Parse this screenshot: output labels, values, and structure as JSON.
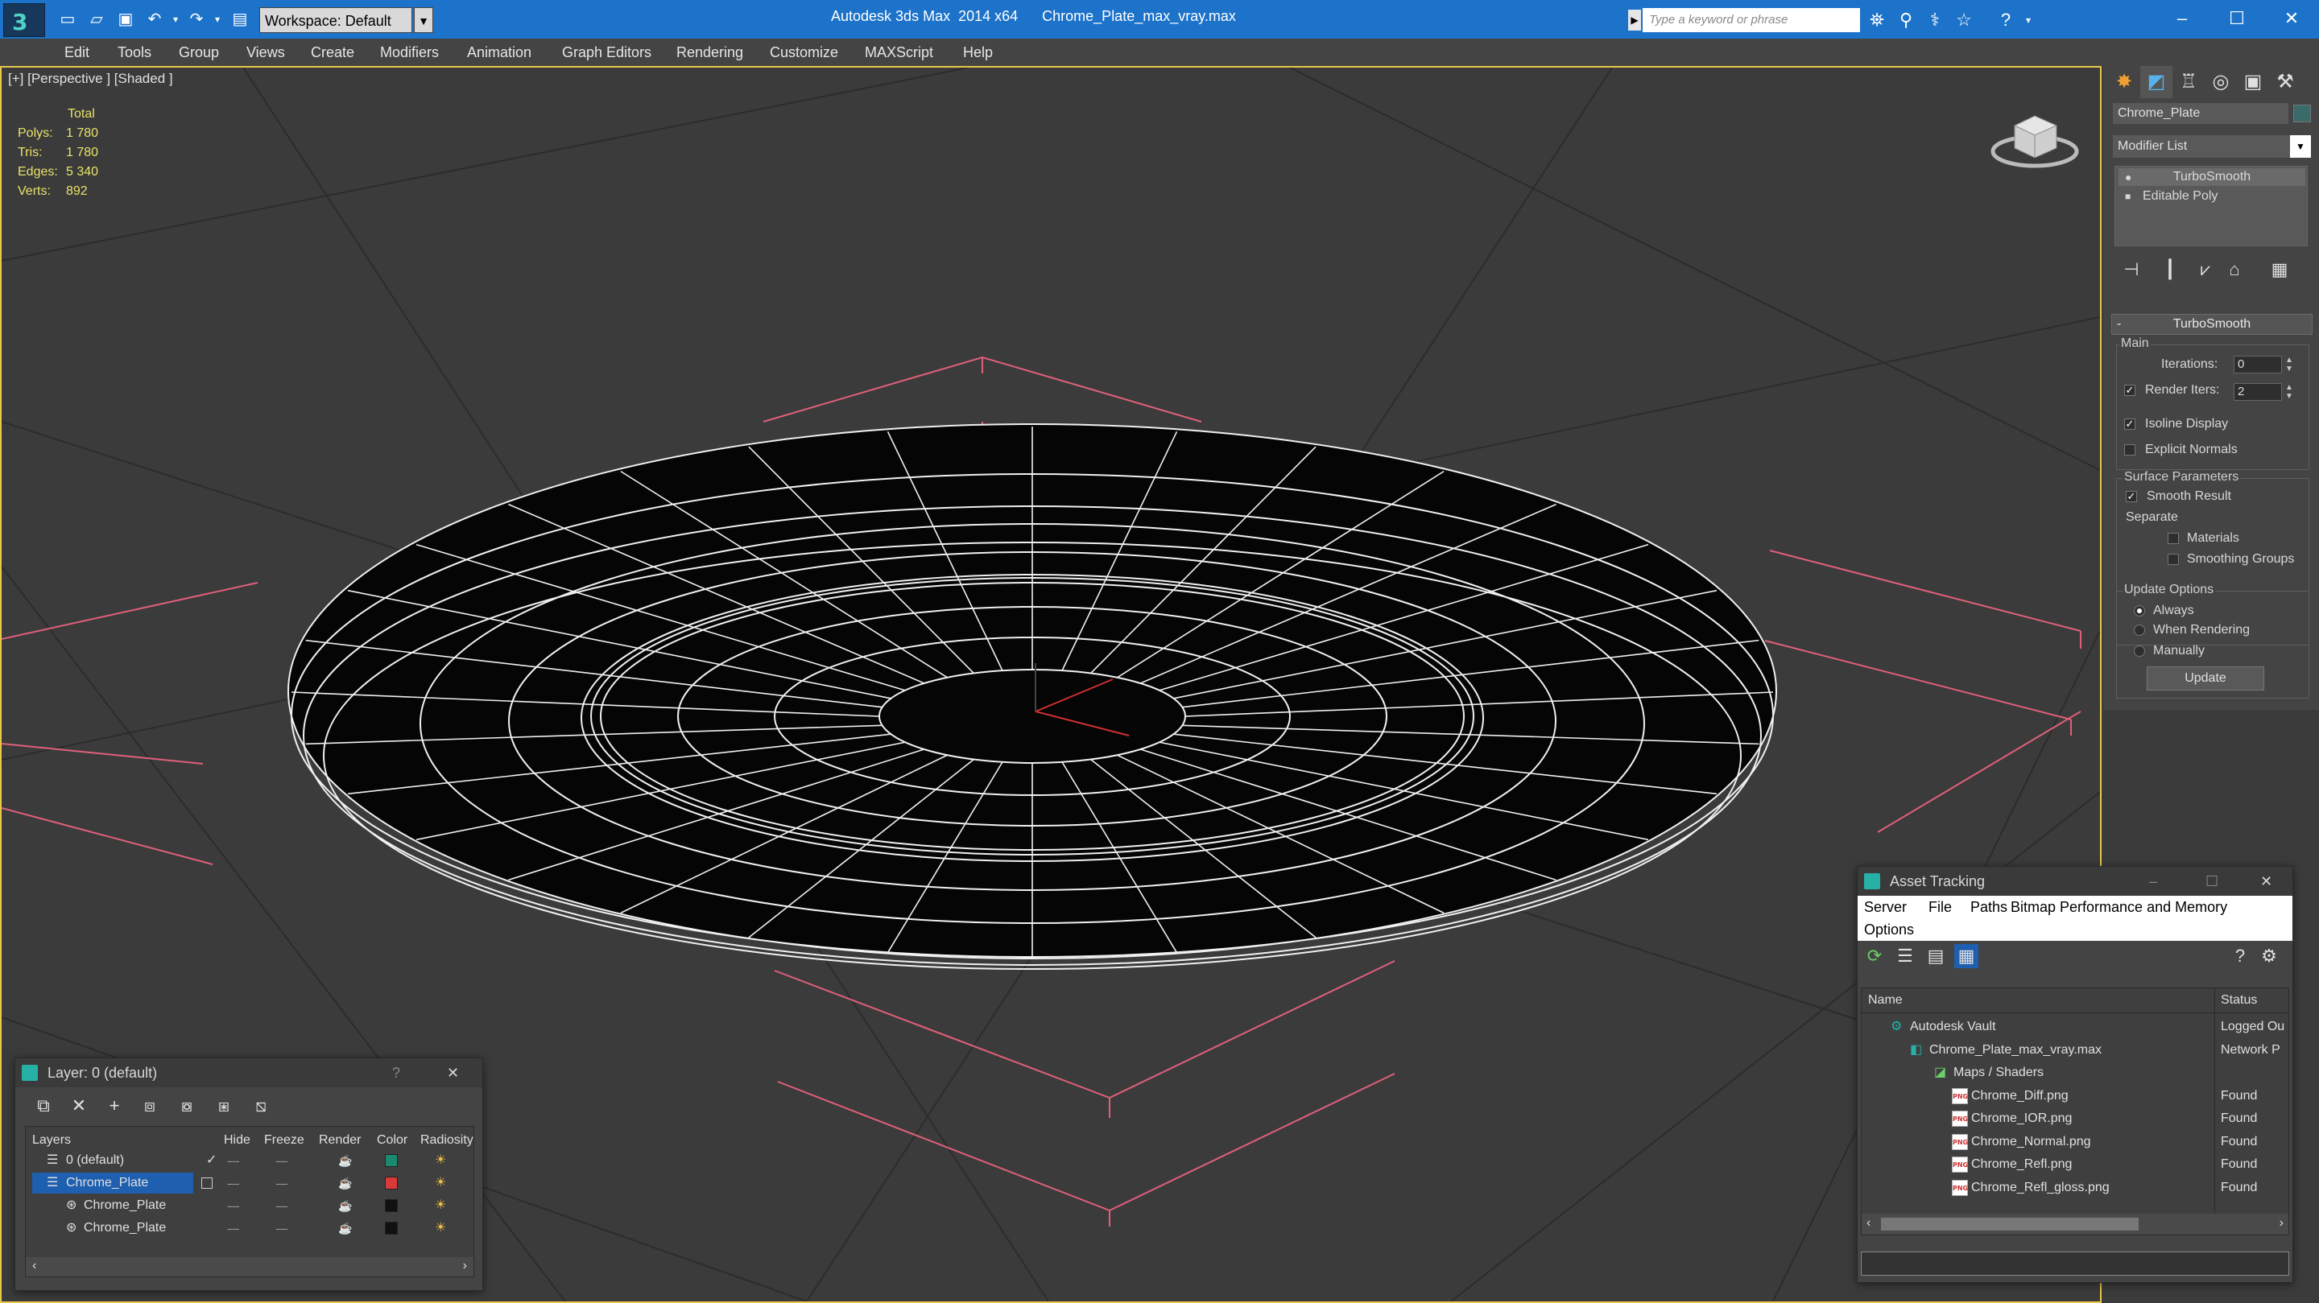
{
  "app": {
    "title": "Autodesk 3ds Max  2014 x64      Chrome_Plate_max_vray.max",
    "workspace": "Workspace: Default",
    "search_placeholder": "Type a keyword or phrase"
  },
  "menu": [
    "Edit",
    "Tools",
    "Group",
    "Views",
    "Create",
    "Modifiers",
    "Animation",
    "Graph Editors",
    "Rendering",
    "Customize",
    "MAXScript",
    "Help"
  ],
  "viewport": {
    "label": "[+] [Perspective ] [Shaded ]",
    "stats": {
      "header": "Total",
      "rows": [
        {
          "label": "Polys:",
          "value": "1 780"
        },
        {
          "label": "Tris:",
          "value": "1 780"
        },
        {
          "label": "Edges:",
          "value": "5 340"
        },
        {
          "label": "Verts:",
          "value": "892"
        }
      ]
    }
  },
  "command_panel": {
    "object_name": "Chrome_Plate",
    "modifier_list": "Modifier List",
    "stack": [
      "TurboSmooth",
      "Editable Poly"
    ],
    "rollout_title": "TurboSmooth",
    "main_group": "Main",
    "iterations_label": "Iterations:",
    "iterations_value": "0",
    "render_iters_label": "Render Iters:",
    "render_iters_value": "2",
    "isoline_display": "Isoline Display",
    "explicit_normals": "Explicit Normals",
    "surface_group": "Surface Parameters",
    "smooth_result": "Smooth Result",
    "separate": "Separate",
    "materials": "Materials",
    "smoothing_groups": "Smoothing Groups",
    "update_group": "Update Options",
    "always": "Always",
    "when_rendering": "When Rendering",
    "manually": "Manually",
    "update_button": "Update"
  },
  "layer_window": {
    "title": "Layer: 0 (default)",
    "help": "?",
    "columns": [
      "Layers",
      "Hide",
      "Freeze",
      "Render",
      "Color",
      "Radiosity"
    ],
    "rows": [
      {
        "name": "0 (default)",
        "color": "#1a8a6e"
      },
      {
        "name": "Chrome_Plate",
        "color": "#d83a3a"
      },
      {
        "name": "Chrome_Plate",
        "color": "#111111"
      },
      {
        "name": "Chrome_Plate",
        "color": "#111111"
      }
    ]
  },
  "asset_window": {
    "title": "Asset Tracking",
    "menu": [
      "Server",
      "File",
      "Paths",
      "Bitmap Performance and Memory",
      "Options"
    ],
    "columns": [
      "Name",
      "Status"
    ],
    "rows": [
      {
        "name": "Autodesk Vault",
        "status": "Logged Ou"
      },
      {
        "name": "Chrome_Plate_max_vray.max",
        "status": "Network P"
      },
      {
        "name": "Maps / Shaders",
        "status": ""
      },
      {
        "name": "Chrome_Diff.png",
        "status": "Found"
      },
      {
        "name": "Chrome_IOR.png",
        "status": "Found"
      },
      {
        "name": "Chrome_Normal.png",
        "status": "Found"
      },
      {
        "name": "Chrome_Refl.png",
        "status": "Found"
      },
      {
        "name": "Chrome_Refl_gloss.png",
        "status": "Found"
      }
    ]
  },
  "colors": {
    "titlebar": "#1d73c9",
    "viewport_border": "#e8c84a",
    "selection": "#1e5fb0",
    "stats": "#e9e26a"
  }
}
